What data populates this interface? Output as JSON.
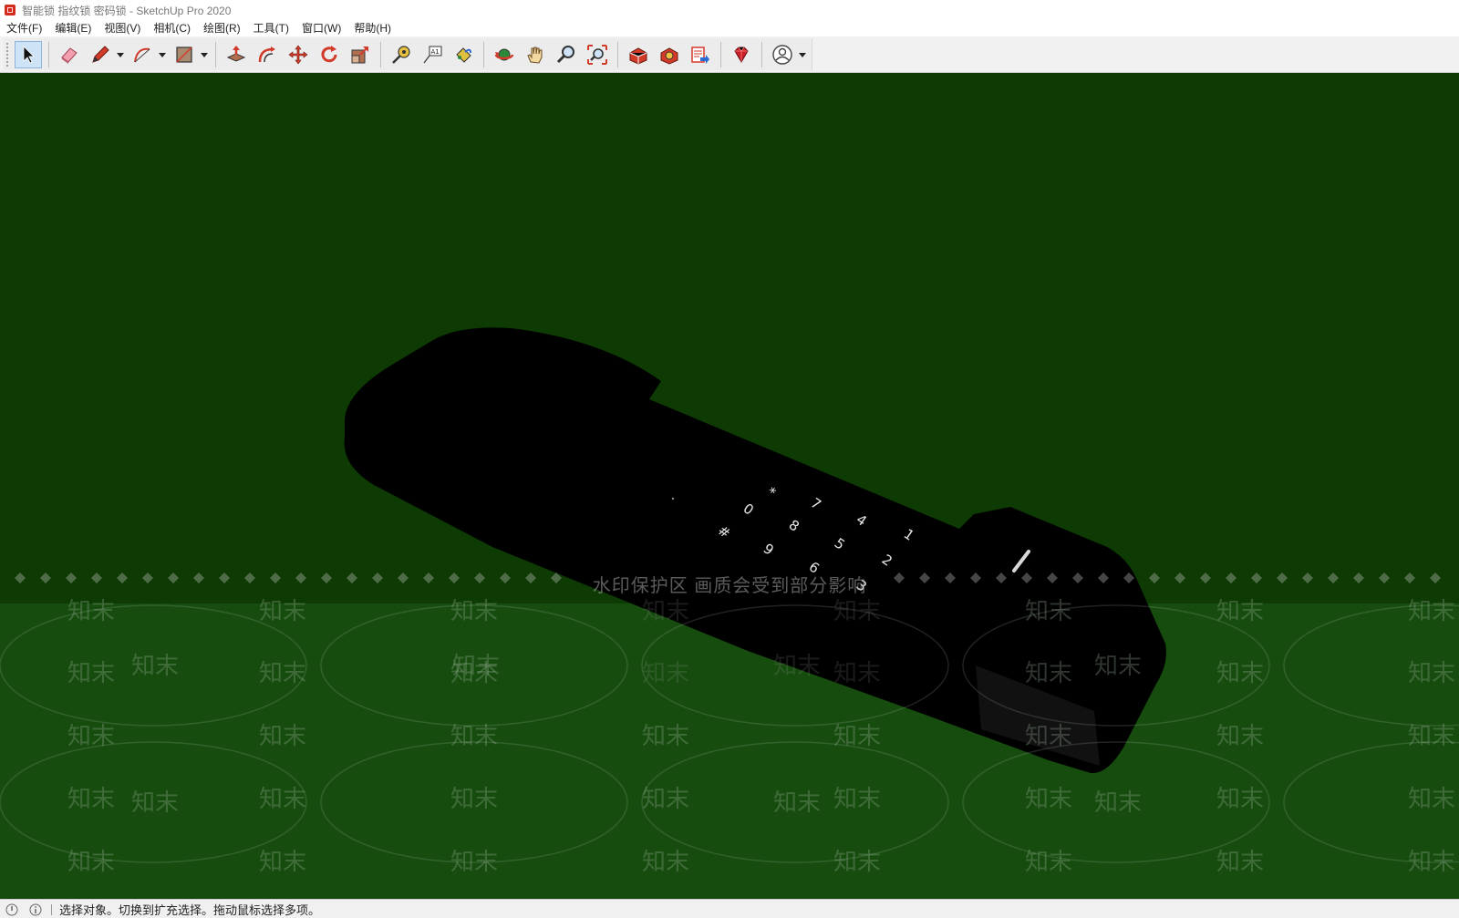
{
  "window": {
    "title": "智能锁 指纹锁 密码锁 - SketchUp Pro 2020"
  },
  "menubar": {
    "items": [
      "文件(F)",
      "编辑(E)",
      "视图(V)",
      "相机(C)",
      "绘图(R)",
      "工具(T)",
      "窗口(W)",
      "帮助(H)"
    ]
  },
  "toolbar": {
    "tools": [
      {
        "name": "select-tool",
        "icon": "arrow-cursor-icon",
        "active": true
      },
      {
        "name": "eraser-tool",
        "icon": "eraser-icon"
      },
      {
        "name": "pencil-tool",
        "icon": "pencil-icon",
        "dropdown": true
      },
      {
        "name": "arc-tool",
        "icon": "arc-icon",
        "dropdown": true
      },
      {
        "name": "rectangle-tool",
        "icon": "rectangle-icon",
        "dropdown": true
      },
      {
        "name": "push-pull-tool",
        "icon": "push-pull-icon"
      },
      {
        "name": "offset-tool",
        "icon": "offset-icon"
      },
      {
        "name": "move-tool",
        "icon": "move-icon"
      },
      {
        "name": "rotate-tool",
        "icon": "rotate-icon"
      },
      {
        "name": "scale-tool",
        "icon": "scale-icon"
      },
      {
        "name": "tape-measure-tool",
        "icon": "tape-measure-icon"
      },
      {
        "name": "text-tool",
        "icon": "text-label-icon",
        "label": "A1"
      },
      {
        "name": "paint-bucket-tool",
        "icon": "paint-bucket-icon"
      },
      {
        "name": "orbit-tool",
        "icon": "orbit-icon"
      },
      {
        "name": "pan-tool",
        "icon": "hand-icon"
      },
      {
        "name": "zoom-tool",
        "icon": "magnifier-icon"
      },
      {
        "name": "zoom-extents-tool",
        "icon": "zoom-extents-icon"
      },
      {
        "name": "warehouse-tool",
        "icon": "warehouse-icon"
      },
      {
        "name": "extension-warehouse-tool",
        "icon": "extension-warehouse-icon"
      },
      {
        "name": "layout-send-tool",
        "icon": "layout-send-icon"
      },
      {
        "name": "extension-manager-tool",
        "icon": "ruby-gem-icon"
      },
      {
        "name": "account-tool",
        "icon": "user-avatar-icon",
        "dropdown": true
      }
    ]
  },
  "viewport": {
    "background": "#0d3b03",
    "ground": "#174c0f",
    "model": "black smart lock",
    "keypad_labels": [
      "*",
      "7",
      "4",
      "1",
      "0",
      "8",
      "5",
      "2",
      "#",
      "9",
      "6",
      "3"
    ],
    "watermark_banner": "水印保护区   画质会受到部分影响",
    "watermark_text": "知末"
  },
  "statusbar": {
    "hint": "选择对象。切换到扩充选择。拖动鼠标选择多项。"
  }
}
